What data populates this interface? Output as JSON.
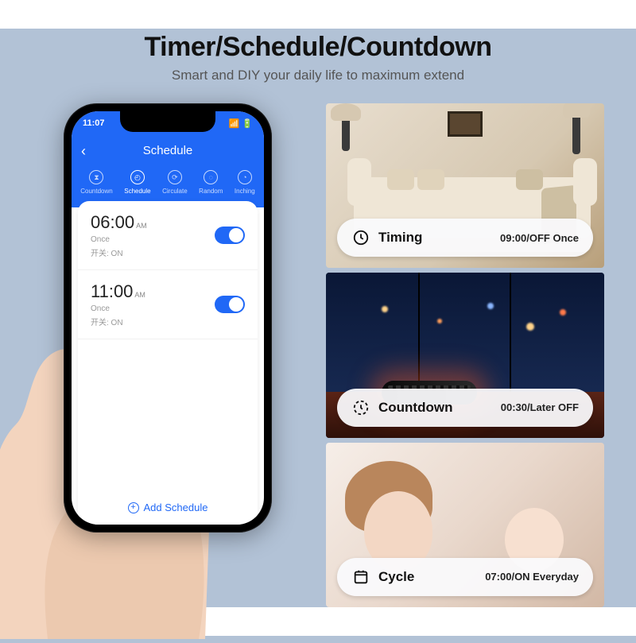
{
  "header": {
    "title": "Timer/Schedule/Countdown",
    "subtitle": "Smart and DIY your daily life to maximum extend"
  },
  "phone": {
    "status_time": "11:07",
    "topbar_title": "Schedule",
    "tabs": [
      "Countdown",
      "Schedule",
      "Circulate",
      "Random",
      "Inching"
    ],
    "schedules": [
      {
        "time": "06:00",
        "ampm": "AM",
        "sub1": "Once",
        "sub2": "开关: ON"
      },
      {
        "time": "11:00",
        "ampm": "AM",
        "sub1": "Once",
        "sub2": "开关: ON"
      }
    ],
    "add_label": "Add Schedule"
  },
  "cards": [
    {
      "label": "Timing",
      "value": "09:00/OFF Once"
    },
    {
      "label": "Countdown",
      "value": "00:30/Later OFF"
    },
    {
      "label": "Cycle",
      "value": "07:00/ON Everyday"
    }
  ]
}
